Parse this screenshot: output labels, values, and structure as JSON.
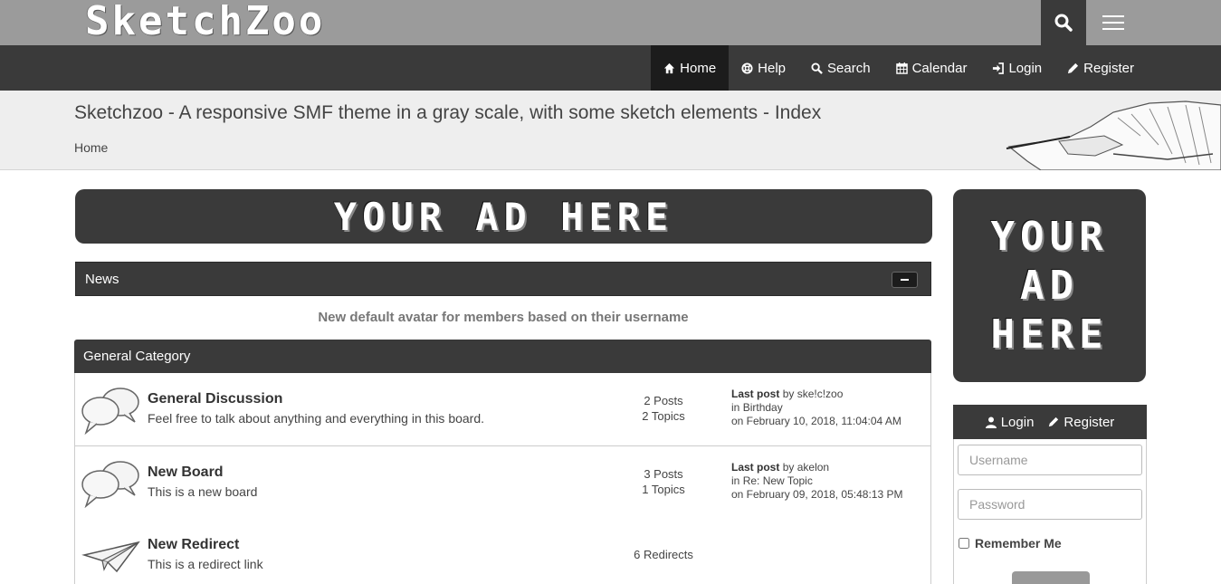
{
  "brand": {
    "logo": "SketchZoo"
  },
  "topbar": {
    "search_icon": "search-icon",
    "menu_icon": "hamburger-icon"
  },
  "nav": {
    "items": [
      {
        "label": "Home",
        "icon": "home-icon",
        "active": true
      },
      {
        "label": "Help",
        "icon": "lifebuoy-icon"
      },
      {
        "label": "Search",
        "icon": "search-icon"
      },
      {
        "label": "Calendar",
        "icon": "calendar-icon"
      },
      {
        "label": "Login",
        "icon": "sign-in-icon"
      },
      {
        "label": "Register",
        "icon": "pencil-icon"
      }
    ]
  },
  "header": {
    "title": "Sketchzoo - A responsive SMF theme in a gray scale, with some sketch elements - Index",
    "breadcrumb": "Home"
  },
  "ads": {
    "wide": "YOUR AD HERE",
    "side": [
      "YOUR",
      "AD",
      "HERE"
    ]
  },
  "news": {
    "title": "News",
    "text": "New default avatar for members based on their username"
  },
  "category": {
    "title": "General Category",
    "boards": [
      {
        "name": "General Discussion",
        "description": "Feel free to talk about anything and everything in this board.",
        "posts": "2 Posts",
        "topics": "2 Topics",
        "last_label": "Last post",
        "last_by_prefix": "by",
        "last_by": "ske!c!zoo",
        "last_in_prefix": "in",
        "last_in": "Birthday",
        "last_on": "on February 10, 2018, 11:04:04 AM"
      },
      {
        "name": "New Board",
        "description": "This is a new board",
        "posts": "3 Posts",
        "topics": "1 Topics",
        "last_label": "Last post",
        "last_by_prefix": "by",
        "last_by": "akelon",
        "last_in_prefix": "in",
        "last_in": "Re: New Topic",
        "last_on": "on February 09, 2018, 05:48:13 PM"
      },
      {
        "name": "New Redirect",
        "description": "This is a redirect link",
        "redirects": "6 Redirects"
      }
    ]
  },
  "login": {
    "login_label": "Login",
    "register_label": "Register",
    "username_placeholder": "Username",
    "password_placeholder": "Password",
    "remember_label": "Remember Me"
  }
}
